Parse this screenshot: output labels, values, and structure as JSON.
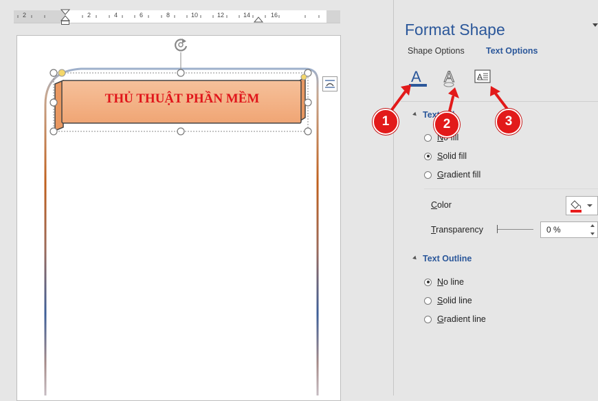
{
  "ruler": {
    "labels": [
      "2",
      "2",
      "4",
      "6",
      "8",
      "10",
      "12",
      "14",
      "16"
    ]
  },
  "document": {
    "banner_text": "THỦ THUẬT PHẦN MỀM"
  },
  "pane": {
    "title": "Format Shape",
    "tabs": {
      "shape_options": "Shape Options",
      "text_options": "Text Options"
    },
    "icons": [
      "text-fill-outline-icon",
      "text-effects-icon",
      "textbox-layout-icon"
    ],
    "text_fill": {
      "header": "Text Fill",
      "options": [
        {
          "label": "No fill",
          "checked": false
        },
        {
          "label": "Solid fill",
          "checked": true
        },
        {
          "label": "Gradient fill",
          "checked": false
        }
      ],
      "color_label": "Color",
      "color_swatch": "#e81c1c",
      "transparency_label": "Transparency",
      "transparency_value": "0 %"
    },
    "text_outline": {
      "header": "Text Outline",
      "options": [
        {
          "label": "No line",
          "checked": true
        },
        {
          "label": "Solid line",
          "checked": false
        },
        {
          "label": "Gradient line",
          "checked": false
        }
      ]
    }
  },
  "annotations": [
    "1",
    "2",
    "3"
  ],
  "colors": {
    "accent": "#2b579a",
    "banner_fill": "#f4b183",
    "banner_text": "#e0161b",
    "marker": "#e21a1a"
  }
}
